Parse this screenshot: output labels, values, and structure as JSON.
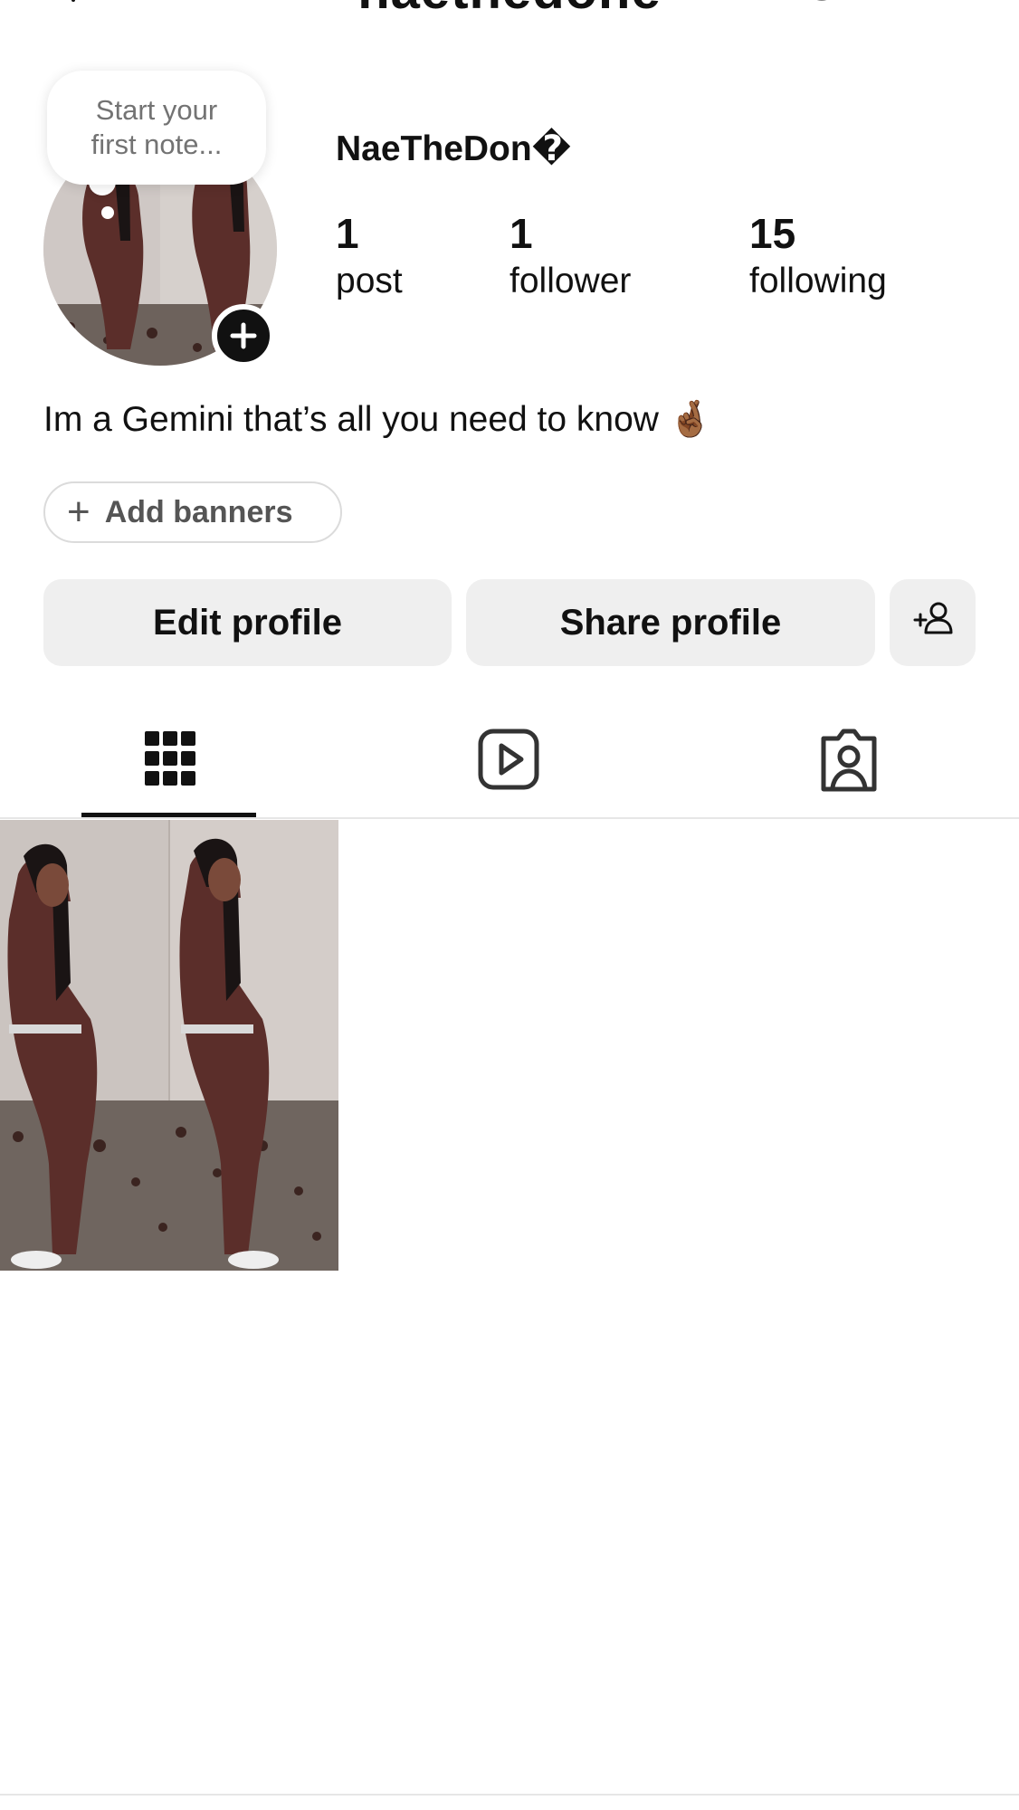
{
  "header": {
    "title": "naethedone",
    "icons": [
      "plus-icon",
      "threads-icon",
      "menu-icon"
    ]
  },
  "note": {
    "placeholder_line1": "Start your",
    "placeholder_line2": "first note..."
  },
  "profile": {
    "display_name": "NaeTheDon�",
    "bio": "Im a Gemini that’s all you need to know 🤞🏾",
    "stats": [
      {
        "value": "1",
        "label": "post"
      },
      {
        "value": "1",
        "label": "follower"
      },
      {
        "value": "15",
        "label": "following"
      }
    ]
  },
  "actions": {
    "add_banners_label": "Add banners",
    "edit_profile_label": "Edit profile",
    "share_profile_label": "Share profile"
  },
  "tabs": [
    {
      "name": "posts-grid",
      "icon": "grid-icon",
      "active": true
    },
    {
      "name": "reels",
      "icon": "reels-icon",
      "active": false
    },
    {
      "name": "tagged",
      "icon": "tagged-icon",
      "active": false
    }
  ],
  "colors": {
    "button_bg": "#efefef",
    "text_primary": "#111111",
    "text_secondary": "#737373",
    "divider": "#e6e6e6"
  }
}
